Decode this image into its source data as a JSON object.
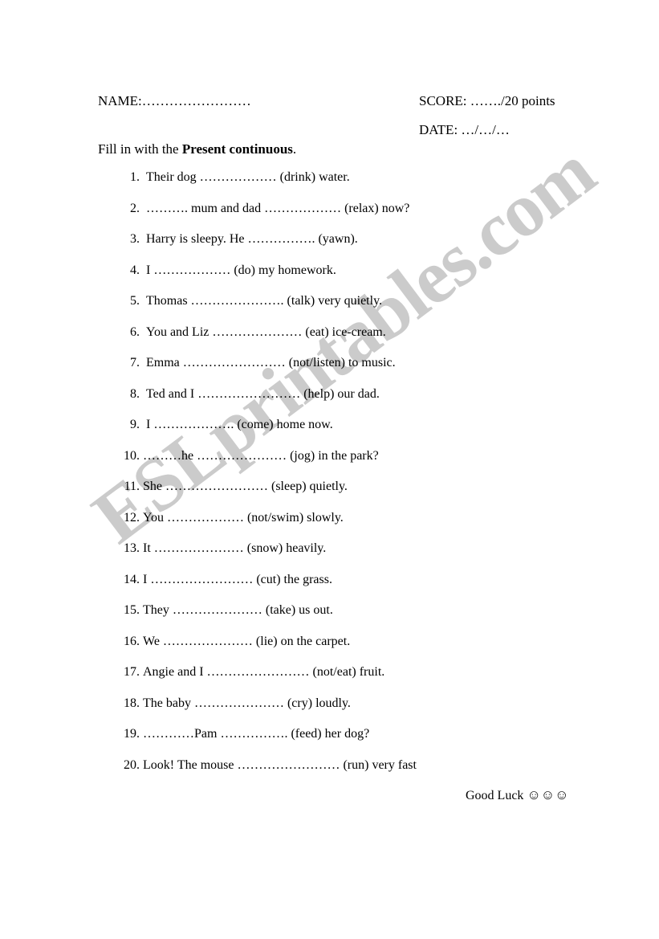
{
  "watermark": {
    "text": "ESLprintables.com",
    "color": "#c9c9c9"
  },
  "header": {
    "name_label": "NAME:……………………",
    "score_label": "SCORE: ……./20 points",
    "date_label": "DATE: …/…/…"
  },
  "instruction": {
    "prefix": "Fill in with the ",
    "emphasis": "Present continuous",
    "suffix": "."
  },
  "questions": [
    {
      "num": "1.",
      "text": "Their dog ……………… (drink) water."
    },
    {
      "num": "2.",
      "text": " ………. mum and dad ……………… (relax) now?"
    },
    {
      "num": "3.",
      "text": "Harry is sleepy. He ……………. (yawn)."
    },
    {
      "num": "4.",
      "text": "I ……………… (do) my homework."
    },
    {
      "num": "5.",
      "text": "Thomas …………………. (talk) very quietly."
    },
    {
      "num": "6.",
      "text": "You and Liz ………………… (eat) ice-cream."
    },
    {
      "num": "7.",
      "text": "Emma …………………… (not/listen) to music."
    },
    {
      "num": "8.",
      "text": "Ted and I …………………… (help) our dad."
    },
    {
      "num": "9.",
      "text": "I ………………. (come) home now."
    },
    {
      "num": "10.",
      "text": "………he ………………… (jog) in the park?"
    },
    {
      "num": "11.",
      "text": "She …………………… (sleep) quietly."
    },
    {
      "num": "12.",
      "text": "You ……………… (not/swim) slowly."
    },
    {
      "num": "13.",
      "text": "It ………………… (snow) heavily."
    },
    {
      "num": "14.",
      "text": "I …………………… (cut) the grass."
    },
    {
      "num": "15.",
      "text": "They ………………… (take) us out."
    },
    {
      "num": "16.",
      "text": "We ………………… (lie) on the carpet."
    },
    {
      "num": "17.",
      "text": "Angie and I …………………… (not/eat) fruit."
    },
    {
      "num": "18.",
      "text": "The baby ………………… (cry) loudly."
    },
    {
      "num": "19.",
      "text": "…………Pam ……………. (feed) her dog?"
    },
    {
      "num": "20.",
      "text": "Look! The mouse …………………… (run) very fast"
    }
  ],
  "footer": {
    "text": "Good Luck ",
    "smileys": "☺☺☺"
  }
}
